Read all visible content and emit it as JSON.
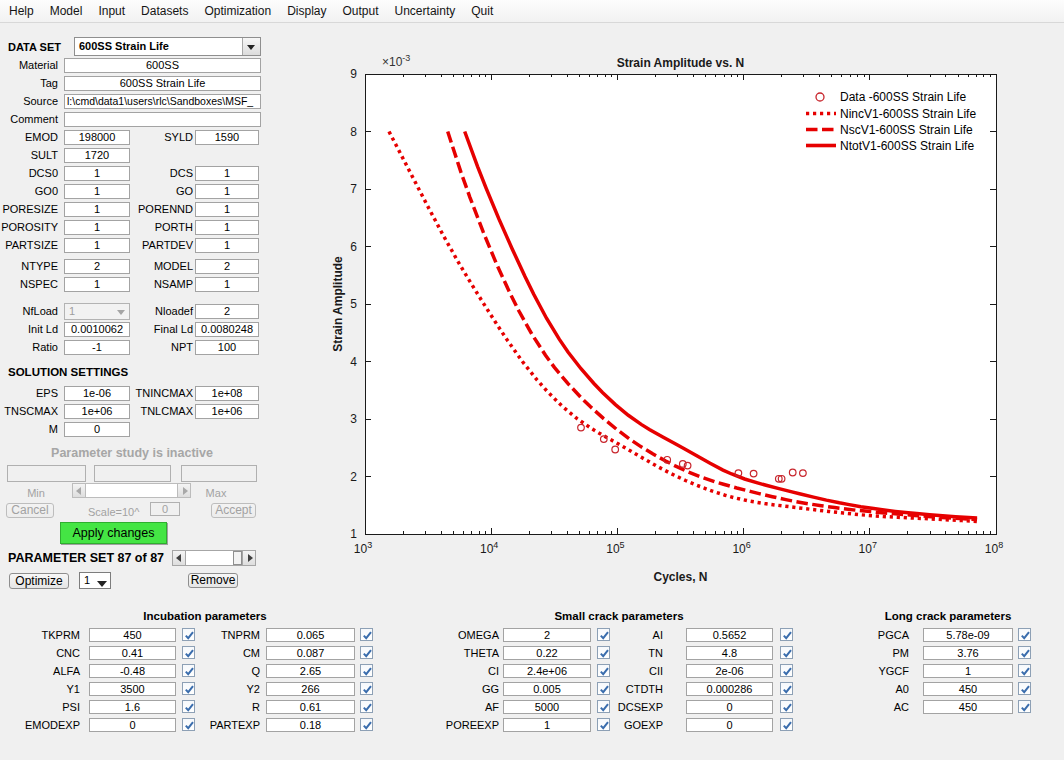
{
  "window": {
    "background": "#f0f0f0"
  },
  "menu": {
    "items": [
      "Help",
      "Model",
      "Input",
      "Datasets",
      "Optimization",
      "Display",
      "Output",
      "Uncertainty",
      "Quit"
    ]
  },
  "dataset": {
    "label": "DATA SET",
    "selected": "600SS Strain Life"
  },
  "info_fields": [
    {
      "label": "Material",
      "value": "600SS"
    },
    {
      "label": "Tag",
      "value": "600SS Strain Life"
    },
    {
      "label": "Source",
      "value": "l:\\cmd\\data1\\users\\rlc\\Sandboxes\\MSF_"
    },
    {
      "label": "Comment",
      "value": ""
    }
  ],
  "material_params": [
    {
      "l": "EMOD",
      "lv": "198000",
      "r": "SYLD",
      "rv": "1590"
    },
    {
      "l": "SULT",
      "lv": "1720"
    },
    {
      "l": "DCS0",
      "lv": "1",
      "r": "DCS",
      "rv": "1"
    },
    {
      "l": "GO0",
      "lv": "1",
      "r": "GO",
      "rv": "1"
    },
    {
      "l": "PORESIZE",
      "lv": "1",
      "r": "PORENND",
      "rv": "1"
    },
    {
      "l": "POROSITY",
      "lv": "1",
      "r": "PORTH",
      "rv": "1"
    },
    {
      "l": "PARTSIZE",
      "lv": "1",
      "r": "PARTDEV",
      "rv": "1"
    }
  ],
  "model_params": [
    {
      "l": "NTYPE",
      "lv": "2",
      "r": "MODEL",
      "rv": "2"
    },
    {
      "l": "NSPEC",
      "lv": "1",
      "r": "NSAMP",
      "rv": "1"
    }
  ],
  "load_params": [
    {
      "l": "NfLoad",
      "lv": "1",
      "disabled_dropdown": true,
      "r": "Nloadef",
      "rv": "2"
    },
    {
      "l": "Init Ld",
      "lv": "0.0010062",
      "r": "Final Ld",
      "rv": "0.0080248"
    },
    {
      "l": "Ratio",
      "lv": "-1",
      "r": "NPT",
      "rv": "100"
    }
  ],
  "solution_settings": {
    "title": "SOLUTION SETTINGS",
    "rows": [
      {
        "l": "EPS",
        "lv": "1e-06",
        "r": "TNINCMAX",
        "rv": "1e+08"
      },
      {
        "l": "TNSCMAX",
        "lv": "1e+06",
        "r": "TNLCMAX",
        "rv": "1e+06"
      },
      {
        "l": "M",
        "lv": "0"
      }
    ]
  },
  "param_study": {
    "status": "Parameter study is inactive",
    "min_value": "",
    "current_value": "",
    "max_value": "",
    "min_label": "Min",
    "max_label": "Max",
    "cancel_label": "Cancel",
    "scale_label": "Scale=10^",
    "scale_value": "0",
    "accept_label": "Accept",
    "apply_label": "Apply changes",
    "apply_color": "#44e544"
  },
  "parameter_set": {
    "label": "PARAMETER SET 87 of 87",
    "optimize_label": "Optimize",
    "selector_value": "1",
    "remove_label": "Remove"
  },
  "param_groups": [
    {
      "title": "Incubation parameters",
      "colA": [
        {
          "label": "TKPRM",
          "value": "450",
          "checked": true
        },
        {
          "label": "CNC",
          "value": "0.41",
          "checked": true
        },
        {
          "label": "ALFA",
          "value": "-0.48",
          "checked": true
        },
        {
          "label": "Y1",
          "value": "3500",
          "checked": true
        },
        {
          "label": "PSI",
          "value": "1.6",
          "checked": true
        },
        {
          "label": "EMODEXP",
          "value": "0",
          "checked": true
        }
      ],
      "colB": [
        {
          "label": "TNPRM",
          "value": "0.065",
          "checked": true
        },
        {
          "label": "CM",
          "value": "0.087",
          "checked": true
        },
        {
          "label": "Q",
          "value": "2.65",
          "checked": true
        },
        {
          "label": "Y2",
          "value": "266",
          "checked": true
        },
        {
          "label": "R",
          "value": "0.61",
          "checked": true
        },
        {
          "label": "PARTEXP",
          "value": "0.18",
          "checked": true
        }
      ]
    },
    {
      "title": "Small crack parameters",
      "colA": [
        {
          "label": "OMEGA",
          "value": "2",
          "checked": true
        },
        {
          "label": "THETA",
          "value": "0.22",
          "checked": true
        },
        {
          "label": "CI",
          "value": "2.4e+06",
          "checked": true
        },
        {
          "label": "GG",
          "value": "0.005",
          "checked": true
        },
        {
          "label": "AF",
          "value": "5000",
          "checked": true
        },
        {
          "label": "POREEXP",
          "value": "1",
          "checked": true
        }
      ],
      "colB": [
        {
          "label": "AI",
          "value": "0.5652",
          "checked": true
        },
        {
          "label": "TN",
          "value": "4.8",
          "checked": true
        },
        {
          "label": "CII",
          "value": "2e-06",
          "checked": true
        },
        {
          "label": "CTDTH",
          "value": "0.000286",
          "checked": true
        },
        {
          "label": "DCSEXP",
          "value": "0",
          "checked": true
        },
        {
          "label": "GOEXP",
          "value": "0",
          "checked": true
        }
      ]
    },
    {
      "title": "Long crack parameters",
      "colA": [
        {
          "label": "PGCA",
          "value": "5.78e-09",
          "checked": true
        },
        {
          "label": "PM",
          "value": "3.76",
          "checked": true
        },
        {
          "label": "YGCF",
          "value": "1",
          "checked": true
        },
        {
          "label": "A0",
          "value": "450",
          "checked": true
        },
        {
          "label": "AC",
          "value": "450",
          "checked": true
        }
      ],
      "colB": []
    }
  ],
  "chart_data": {
    "type": "line",
    "title": "Strain Amplitude vs. N",
    "xlabel": "Cycles, N",
    "ylabel": "Strain Amplitude",
    "y_multiplier_base": "×10",
    "y_multiplier_exp": "-3",
    "xscale": "log",
    "xlim": [
      1000,
      100000000
    ],
    "ylim": [
      0.001,
      0.009
    ],
    "y_ticks": [
      1,
      2,
      3,
      4,
      5,
      6,
      7,
      8,
      9
    ],
    "x_tick_exponents": [
      3,
      4,
      5,
      6,
      7,
      8
    ],
    "grid": false,
    "legend_position": "northeast",
    "line_color": "#e60000",
    "marker_color": "#c8252c",
    "series": [
      {
        "name": "Data -600SS Strain Life",
        "type": "scatter",
        "marker": "circle",
        "points": [
          [
            51500,
            2.85
          ],
          [
            78000,
            2.65
          ],
          [
            96000,
            2.47
          ],
          [
            248000,
            2.29
          ],
          [
            330000,
            2.22
          ],
          [
            360000,
            2.19
          ],
          [
            910000,
            2.06
          ],
          [
            1200000,
            2.05
          ],
          [
            1900000,
            1.96
          ],
          [
            2000000,
            1.96
          ],
          [
            2450000,
            2.07
          ],
          [
            2950000,
            2.06
          ]
        ]
      },
      {
        "name": "NincV1-600SS Strain Life",
        "type": "line",
        "style": "dotted",
        "points": [
          [
            1549.0,
            8.0
          ],
          [
            2030.0,
            7.505
          ],
          [
            2431.0,
            7.17
          ],
          [
            3186.0,
            6.675
          ],
          [
            4176.0,
            6.191
          ],
          [
            5473.0,
            5.732
          ],
          [
            6555.0,
            5.443
          ],
          [
            8591.0,
            5.026
          ],
          [
            11260.0,
            4.622
          ],
          [
            13480.0,
            4.363
          ],
          [
            17670.0,
            4.0
          ],
          [
            23160.0,
            3.676
          ],
          [
            27740.0,
            3.483
          ],
          [
            36360.0,
            3.225
          ],
          [
            47650.0,
            3.01
          ],
          [
            62450.0,
            2.833
          ],
          [
            74790.0,
            2.73
          ],
          [
            98030.0,
            2.586
          ],
          [
            128500.0,
            2.438
          ],
          [
            153900.0,
            2.337
          ],
          [
            201700.0,
            2.189
          ],
          [
            264300.0,
            2.052
          ],
          [
            346400.0,
            1.931
          ],
          [
            414900.0,
            1.858
          ],
          [
            543700.0,
            1.759
          ],
          [
            712600.0,
            1.674
          ],
          [
            853400.0,
            1.627
          ],
          [
            1119000.0,
            1.57
          ],
          [
            1466000.0,
            1.529
          ],
          [
            1756000.0,
            1.506
          ],
          [
            2301000.0,
            1.475
          ],
          [
            3016000.0,
            1.444
          ],
          [
            3953000.0,
            1.413
          ],
          [
            4734000.0,
            1.393
          ],
          [
            6204000.0,
            1.363
          ],
          [
            8131000.0,
            1.337
          ],
          [
            9738000.0,
            1.323
          ],
          [
            12760000.0,
            1.305
          ],
          [
            16730000.0,
            1.29
          ],
          [
            20030000.0,
            1.281
          ],
          [
            26260000.0,
            1.269
          ],
          [
            34410000.0,
            1.256
          ],
          [
            45100000.0,
            1.242
          ],
          [
            54020000.0,
            1.233
          ],
          [
            70790000.0,
            1.22
          ]
        ]
      },
      {
        "name": "NscV1-600SS Strain Life",
        "type": "line",
        "style": "dashed",
        "points": [
          [
            4519.0,
            8.0
          ],
          [
            5764.0,
            7.289
          ],
          [
            6780.0,
            6.856
          ],
          [
            8650.0,
            6.249
          ],
          [
            11040.0,
            5.694
          ],
          [
            14080.0,
            5.188
          ],
          [
            16560.0,
            4.881
          ],
          [
            21120.0,
            4.466
          ],
          [
            26950.0,
            4.108
          ],
          [
            31700.0,
            3.898
          ],
          [
            40440.0,
            3.619
          ],
          [
            51590.0,
            3.373
          ],
          [
            60680.0,
            3.221
          ],
          [
            77410.0,
            3.011
          ],
          [
            98760.0,
            2.819
          ],
          [
            126000.0,
            2.646
          ],
          [
            148200.0,
            2.541
          ],
          [
            189100.0,
            2.398
          ],
          [
            241200.0,
            2.269
          ],
          [
            283700.0,
            2.19
          ],
          [
            361900.0,
            2.082
          ],
          [
            461700.0,
            1.989
          ],
          [
            589000.0,
            1.91
          ],
          [
            692800.0,
            1.864
          ],
          [
            883900.0,
            1.8
          ],
          [
            1128000.0,
            1.74
          ],
          [
            1326000.0,
            1.702
          ],
          [
            1692000.0,
            1.648
          ],
          [
            2159000.0,
            1.598
          ],
          [
            2539000.0,
            1.567
          ],
          [
            3239000.0,
            1.527
          ],
          [
            4132000.0,
            1.491
          ],
          [
            5271000.0,
            1.459
          ],
          [
            6201000.0,
            1.44
          ],
          [
            7910000.0,
            1.413
          ],
          [
            10090000.0,
            1.389
          ],
          [
            11870000.0,
            1.374
          ],
          [
            15140000.0,
            1.354
          ],
          [
            19320000.0,
            1.335
          ],
          [
            22720000.0,
            1.323
          ],
          [
            28990000.0,
            1.306
          ],
          [
            36980000.0,
            1.289
          ],
          [
            47180000.0,
            1.274
          ],
          [
            55490000.0,
            1.264
          ],
          [
            70790000.0,
            1.25
          ]
        ]
      },
      {
        "name": "NtotV1-600SS Strain Life",
        "type": "line",
        "style": "solid",
        "points": [
          [
            6166.0,
            8.0
          ],
          [
            7805.0,
            7.39
          ],
          [
            9132.0,
            7.012
          ],
          [
            11560.0,
            6.471
          ],
          [
            14630.0,
            5.961
          ],
          [
            18520.0,
            5.478
          ],
          [
            21670.0,
            5.174
          ],
          [
            27430.0,
            4.753
          ],
          [
            34720.0,
            4.384
          ],
          [
            40630.0,
            4.166
          ],
          [
            51430.0,
            3.875
          ],
          [
            65090.0,
            3.618
          ],
          [
            76170.0,
            3.463
          ],
          [
            96410.0,
            3.251
          ],
          [
            122000.0,
            3.065
          ],
          [
            154500.0,
            2.906
          ],
          [
            180700.0,
            2.814
          ],
          [
            228800.0,
            2.687
          ],
          [
            289600.0,
            2.566
          ],
          [
            338800.0,
            2.484
          ],
          [
            428900.0,
            2.356
          ],
          [
            542900.0,
            2.229
          ],
          [
            687200.0,
            2.112
          ],
          [
            804100.0,
            2.043
          ],
          [
            1018000.0,
            1.957
          ],
          [
            1288000.0,
            1.888
          ],
          [
            1507000.0,
            1.847
          ],
          [
            1908000.0,
            1.789
          ],
          [
            2415000.0,
            1.733
          ],
          [
            2826000.0,
            1.695
          ],
          [
            3577000.0,
            1.641
          ],
          [
            4528000.0,
            1.59
          ],
          [
            5731000.0,
            1.543
          ],
          [
            6706000.0,
            1.514
          ],
          [
            8488000.0,
            1.475
          ],
          [
            10740000.0,
            1.441
          ],
          [
            12570000.0,
            1.421
          ],
          [
            15910000.0,
            1.393
          ],
          [
            20140000.0,
            1.369
          ],
          [
            23570000.0,
            1.355
          ],
          [
            29830000.0,
            1.335
          ],
          [
            37760000.0,
            1.317
          ],
          [
            47800000.0,
            1.301
          ],
          [
            55930000.0,
            1.292
          ],
          [
            70790000.0,
            1.28
          ]
        ]
      }
    ]
  }
}
